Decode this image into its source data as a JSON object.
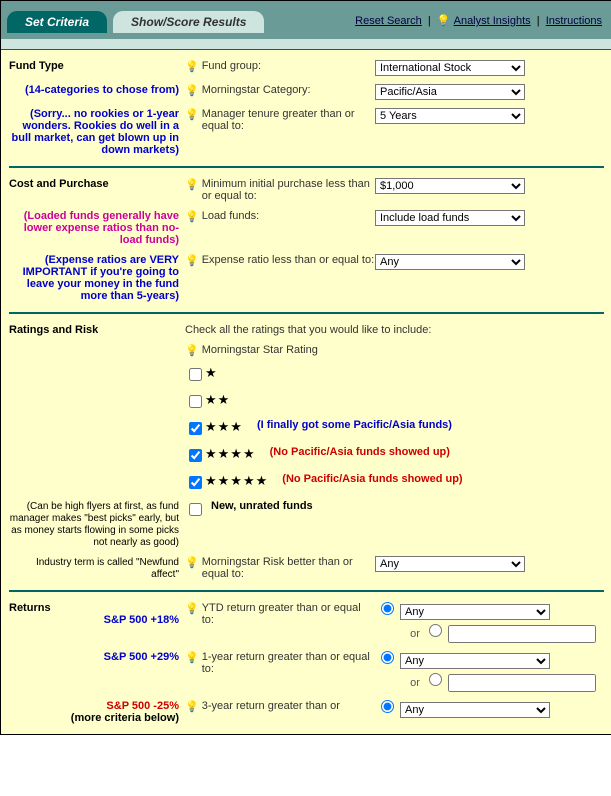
{
  "tabs": {
    "set_criteria": "Set Criteria",
    "show_score": "Show/Score Results"
  },
  "toplinks": {
    "reset": "Reset Search",
    "insights": "Analyst Insights",
    "instructions": "Instructions"
  },
  "sections": {
    "fund_type": {
      "title": "Fund Type",
      "fund_group": {
        "label": "Fund group:",
        "value": "International Stock"
      },
      "note1": "(14-categories to chose from)",
      "category": {
        "label": "Morningstar Category:",
        "value": "Pacific/Asia"
      },
      "note2": "(Sorry... no rookies or 1-year wonders. Rookies do well in a bull market, can get blown up in down markets)",
      "tenure": {
        "label": "Manager tenure greater than or equal to:",
        "value": "5 Years"
      }
    },
    "cost": {
      "title": "Cost and Purchase",
      "min_initial": {
        "label": "Minimum initial purchase less than or equal to:",
        "value": "$1,000"
      },
      "note1": "(Loaded funds generally have lower expense ratios than no-load funds)",
      "load": {
        "label": "Load funds:",
        "value": "Include load funds"
      },
      "note2": "(Expense ratios are VERY IMPORTANT if you're going to leave your money in the fund more than 5-years)",
      "expense": {
        "label": "Expense ratio less than or equal to:",
        "value": "Any"
      }
    },
    "ratings": {
      "title": "Ratings and Risk",
      "intro": "Check all the ratings that you would like to include:",
      "rating_label": "Morningstar Star Rating",
      "stars": [
        {
          "c": false,
          "n": 1,
          "note": ""
        },
        {
          "c": false,
          "n": 2,
          "note": ""
        },
        {
          "c": true,
          "n": 3,
          "note": "(I finally got some Pacific/Asia funds)",
          "cls": "note-blue"
        },
        {
          "c": true,
          "n": 4,
          "note": "(No Pacific/Asia funds showed up)",
          "cls": "note-red"
        },
        {
          "c": true,
          "n": 5,
          "note": "(No Pacific/Asia funds showed up)",
          "cls": "note-red"
        }
      ],
      "new_unrated": {
        "c": false,
        "label": "New, unrated funds"
      },
      "side_note": "(Can be high flyers at first, as fund manager makes \"best picks\" early, but as money starts flowing in some picks not nearly as good)",
      "side_note2": "Industry term is called \"Newfund affect\"",
      "risk": {
        "label": "Morningstar Risk better than or equal to:",
        "value": "Any"
      }
    },
    "returns": {
      "title": "Returns",
      "sp1": "S&P 500 +18%",
      "ytd": {
        "label": "YTD return greater than or equal to:",
        "value": "Any"
      },
      "or": "or",
      "sp2": "S&P 500 +29%",
      "yr1": {
        "label": "1-year return greater than or equal to:",
        "value": "Any"
      },
      "sp3": "S&P 500 -25%",
      "more": "(more criteria below)",
      "yr3": {
        "label": "3-year return greater than or",
        "value": "Any"
      }
    }
  }
}
